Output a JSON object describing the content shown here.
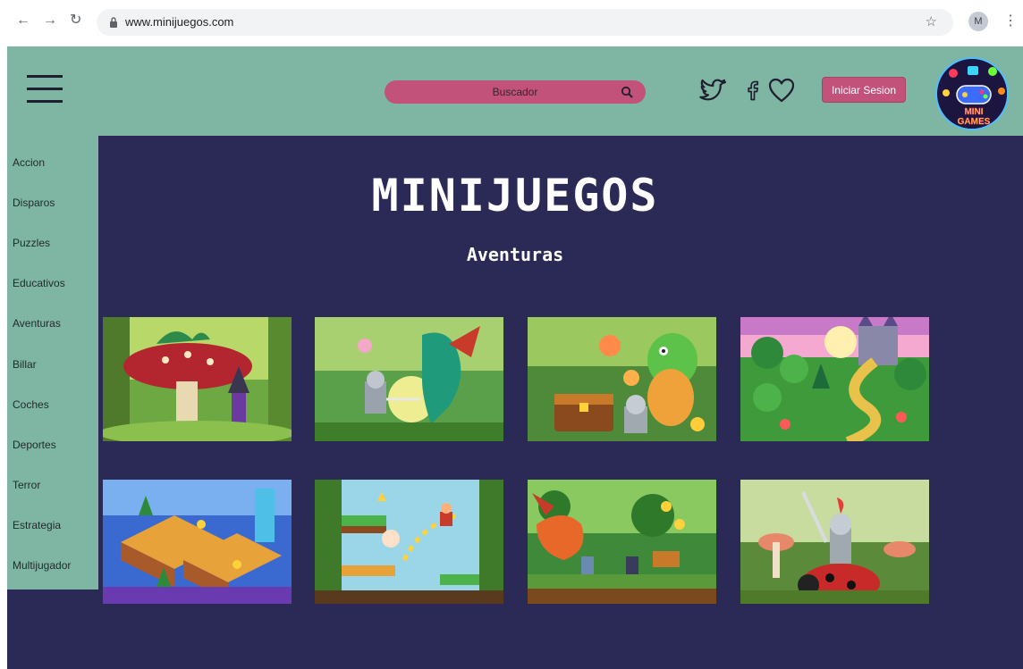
{
  "browser": {
    "url": "www.minijuegos.com",
    "profile_initial": "M"
  },
  "header": {
    "search_placeholder": "Buscador",
    "login_label": "Iniciar Sesion",
    "logo_text_1": "MINI",
    "logo_text_2": "GAMES"
  },
  "main": {
    "title": "MINIJUEGOS",
    "subtitle": "Aventuras"
  },
  "sidebar": {
    "items": [
      {
        "label": "Accion"
      },
      {
        "label": "Disparos"
      },
      {
        "label": "Puzzles"
      },
      {
        "label": "Educativos"
      },
      {
        "label": "Aventuras"
      },
      {
        "label": "Billar"
      },
      {
        "label": "Coches"
      },
      {
        "label": "Deportes"
      },
      {
        "label": "Terror"
      },
      {
        "label": "Estrategia"
      },
      {
        "label": "Multijugador"
      }
    ]
  },
  "colors": {
    "header_bg": "#7fb5a3",
    "main_bg": "#2b2a56",
    "accent": "#c2527a"
  },
  "icons": [
    "back-arrow-icon",
    "forward-arrow-icon",
    "reload-icon",
    "lock-icon",
    "star-icon",
    "menu-dots-icon",
    "hamburger-icon",
    "search-icon",
    "twitter-icon",
    "facebook-icon",
    "heart-icon"
  ]
}
